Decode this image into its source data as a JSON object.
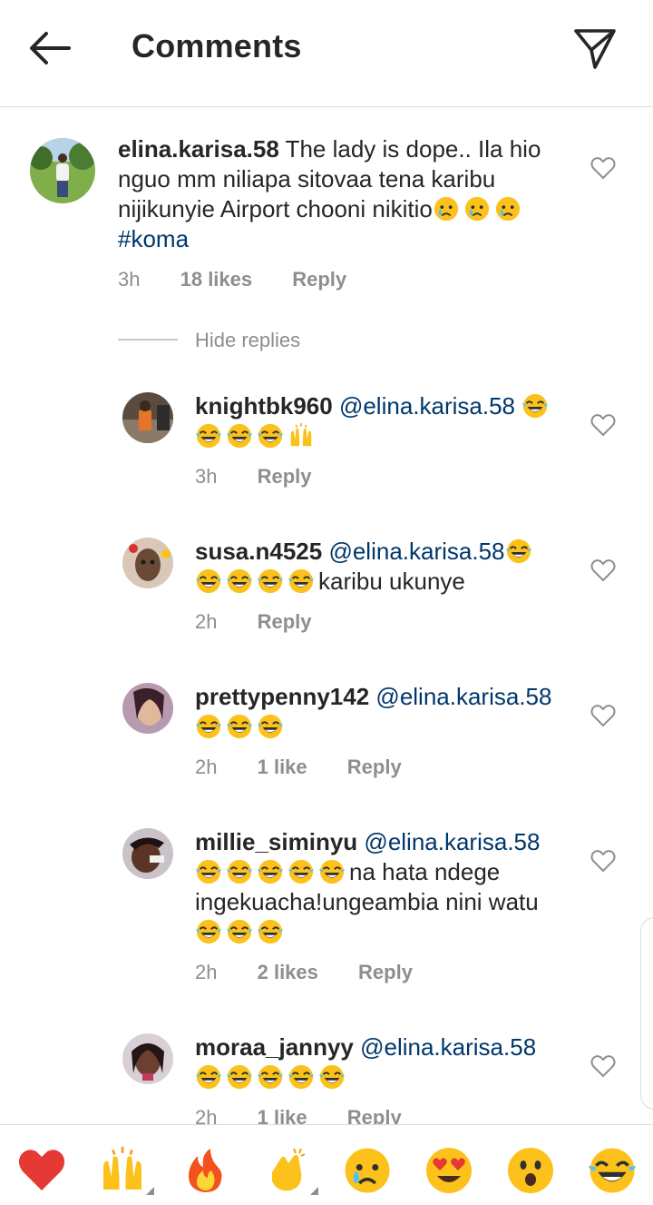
{
  "header": {
    "title": "Comments",
    "back_icon": "arrow-left-icon",
    "send_icon": "paper-plane-icon"
  },
  "colors": {
    "mention": "#00376b",
    "meta": "#8e8e8e",
    "text": "#262626",
    "divider": "#dbdbdb"
  },
  "main_comment": {
    "user": "elina.karisa.58",
    "text_line1": "The lady is dope.. Ila hio",
    "text_line2": "nguo mm niliapa sitovaa tena karibu",
    "text_line3": "nijikunyie Airport chooni nikitio",
    "hashtag": "#koma",
    "time": "3h",
    "likes": "18 likes",
    "reply": "Reply"
  },
  "hide_replies": "Hide replies",
  "replies": [
    {
      "user": "knightbk960",
      "mention": "@elina.karisa.58",
      "time": "3h",
      "likes": "",
      "reply": "Reply"
    },
    {
      "user": "susa.n4525",
      "mention": "@elina.karisa.58",
      "tail": "karibu ukunye",
      "time": "2h",
      "likes": "",
      "reply": "Reply"
    },
    {
      "user": "prettypenny142",
      "mention": "@elina.karisa.58",
      "time": "2h",
      "likes": "1 like",
      "reply": "Reply"
    },
    {
      "user": "millie_siminyu",
      "mention": "@elina.karisa.58",
      "tail1": "na hata ndege",
      "line2": "ingekuacha!ungeambia nini watu",
      "time": "2h",
      "likes": "2 likes",
      "reply": "Reply"
    },
    {
      "user": "moraa_jannyy",
      "mention": "@elina.karisa.58",
      "time": "2h",
      "likes": "1 like",
      "reply": "Reply"
    }
  ],
  "emoji_bar": [
    {
      "name": "red-heart-icon",
      "glyph": "❤️"
    },
    {
      "name": "raising-hands-icon",
      "glyph": "🙌"
    },
    {
      "name": "fire-icon",
      "glyph": "🔥"
    },
    {
      "name": "clapping-hands-icon",
      "glyph": "👏"
    },
    {
      "name": "crying-face-icon",
      "glyph": "😢"
    },
    {
      "name": "heart-eyes-icon",
      "glyph": "😍"
    },
    {
      "name": "surprised-face-icon",
      "glyph": "😮"
    },
    {
      "name": "tears-of-joy-icon",
      "glyph": "😂"
    }
  ]
}
